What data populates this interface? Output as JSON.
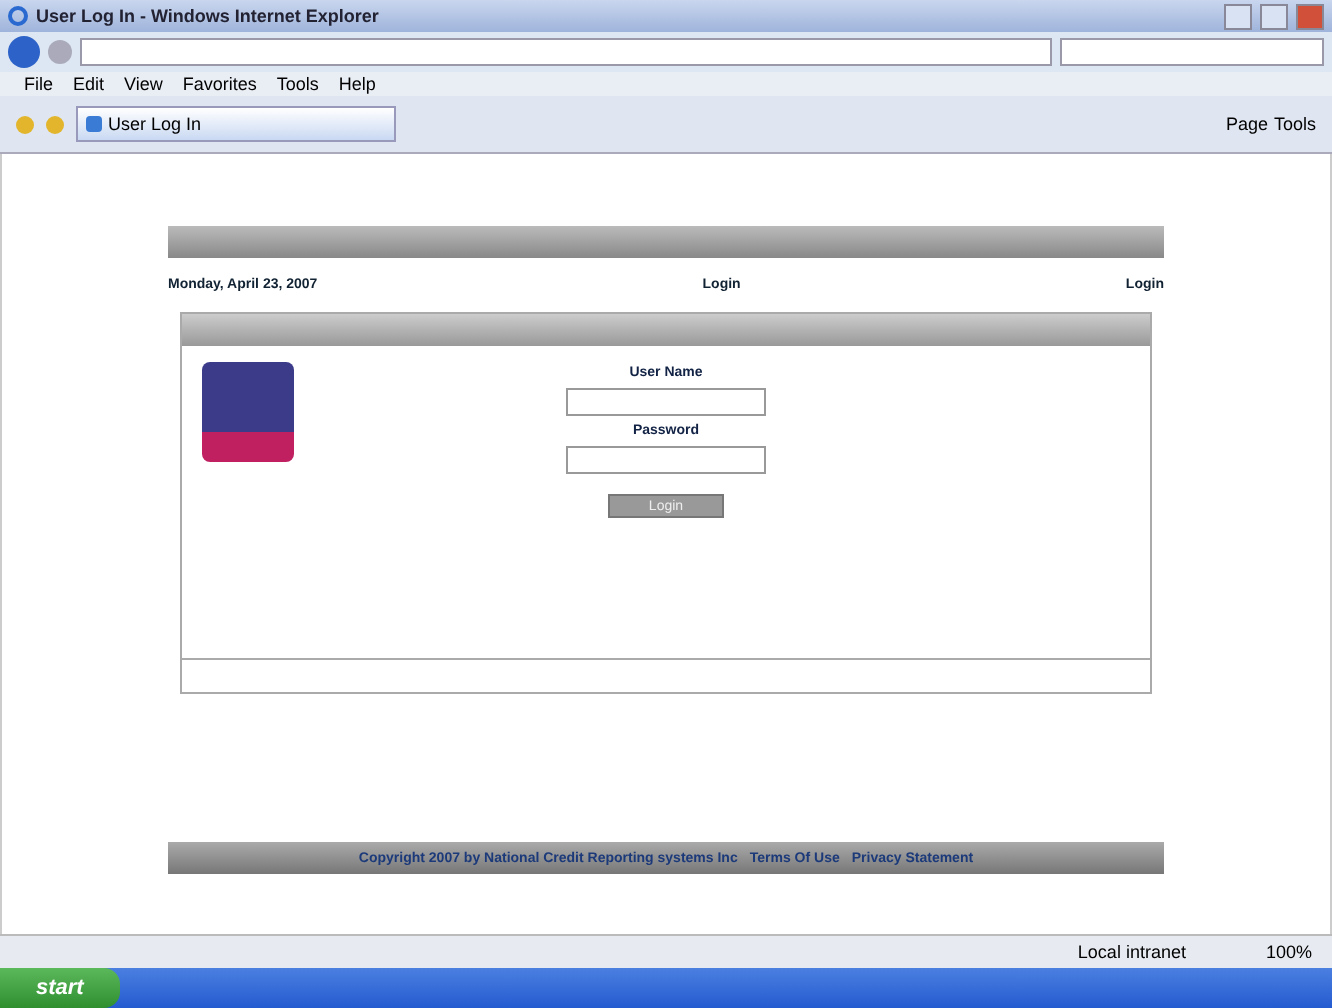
{
  "window": {
    "title": "User Log In - Windows Internet Explorer"
  },
  "menu": [
    "File",
    "Edit",
    "View",
    "Favorites",
    "Tools",
    "Help"
  ],
  "tab": {
    "label": "User Log In"
  },
  "command_bar": [
    "Page",
    "Tools"
  ],
  "page": {
    "date": "Monday, April 23, 2007",
    "heading": "Login",
    "top_link": "Login",
    "form": {
      "fields": [
        {
          "label": "User Name"
        },
        {
          "label": "Password"
        }
      ],
      "button": "Login"
    },
    "footer": {
      "copyright": "Copyright 2007 by National Credit Reporting systems Inc",
      "links": [
        "Terms Of Use",
        "Privacy Statement"
      ]
    }
  },
  "status_bar": {
    "zone": "Local intranet",
    "zoom": "100%"
  },
  "taskbar": {
    "start": "start"
  }
}
